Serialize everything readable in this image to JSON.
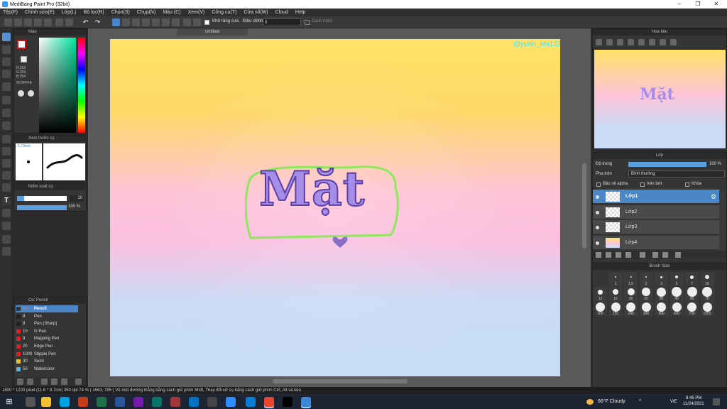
{
  "window": {
    "title": "MediBang Paint Pro (32bit)"
  },
  "menu": [
    "Tệp(F)",
    "Chỉnh sửa(E)",
    "Lớp(L)",
    "Bộ lọc(R)",
    "Chọn(S)",
    "Chụp(N)",
    "Màu (C)",
    "Xem(V)",
    "Công cụ(T)",
    "Cửa sổ(W)",
    "Cloud",
    "Help"
  ],
  "toolbar": {
    "antialias": "Khử răng cưa",
    "adjust": "Điều chỉnh",
    "adjust_value": "0",
    "snap": "Canh mềm"
  },
  "document": {
    "tab": "Untitled",
    "artwork_text": "Mặt",
    "signature": "@yunn_nhi1Sh7"
  },
  "color_panel": {
    "title": "Màu",
    "r": "R:253",
    "g": "G:255",
    "b": "B:254",
    "hex": "#FDFFFE"
  },
  "brush_preview": {
    "title": "Xem trước cọ",
    "size": "5.73mm"
  },
  "brush_control": {
    "title": "Kiểm soát cọ",
    "size_value": "10",
    "opacity_value": "100 %"
  },
  "brush_list": {
    "title": "Cọ: Pencil",
    "items": [
      {
        "size": "10",
        "name": "Pencil",
        "color": "#333333",
        "selected": true
      },
      {
        "size": "8",
        "name": "Pen",
        "color": "#222222"
      },
      {
        "size": "8",
        "name": "Pen (Sharp)",
        "color": "#222222"
      },
      {
        "size": "10",
        "name": "G Pen",
        "color": "#e02020"
      },
      {
        "size": "8",
        "name": "Mapping Pen",
        "color": "#e02020"
      },
      {
        "size": "20",
        "name": "Edge Pen",
        "color": "#e02020"
      },
      {
        "size": "1000",
        "name": "Stipple Pen",
        "color": "#e02020"
      },
      {
        "size": "30",
        "name": "Sumi",
        "color": "#f0c020"
      },
      {
        "size": "50",
        "name": "Watercolor",
        "color": "#5ab0e0"
      }
    ]
  },
  "navigator": {
    "title": "Hoa tiêu"
  },
  "layers": {
    "title": "Lớp",
    "opacity_label": "Độ trong",
    "opacity_value": "100 %",
    "blend_label": "Pha trộn",
    "blend_value": "Bình thường",
    "protect_alpha": "Bảo vệ alpha",
    "clipping": "Xén bớt",
    "lock": "Khóa",
    "items": [
      "Lớp1",
      "Lớp2",
      "Lớp3",
      "Lớp4"
    ]
  },
  "brush_size": {
    "title": "Brush Size",
    "labels": [
      "1",
      "1.5",
      "2",
      "3",
      "5",
      "7",
      "10",
      "12",
      "15",
      "20",
      "25",
      "30",
      "40",
      "50",
      "70",
      "100",
      "150",
      "200",
      "300",
      "400",
      "500",
      "700",
      "1000"
    ]
  },
  "status": {
    "text": "1600 * 1200 pixel   (11.6 * 8.7cm)   350 dpi   74 %   ( 1663, 785 )   Vẽ một đường thẳng bằng cách giữ phím Shift, Thay đổi cỡ cọ bằng cách giữ phím Ctrl, Alt và kéo"
  },
  "taskbar": {
    "weather": "66°F  Cloudy",
    "lang": "VIE",
    "time": "8:45 PM",
    "date": "11/24/2021"
  }
}
